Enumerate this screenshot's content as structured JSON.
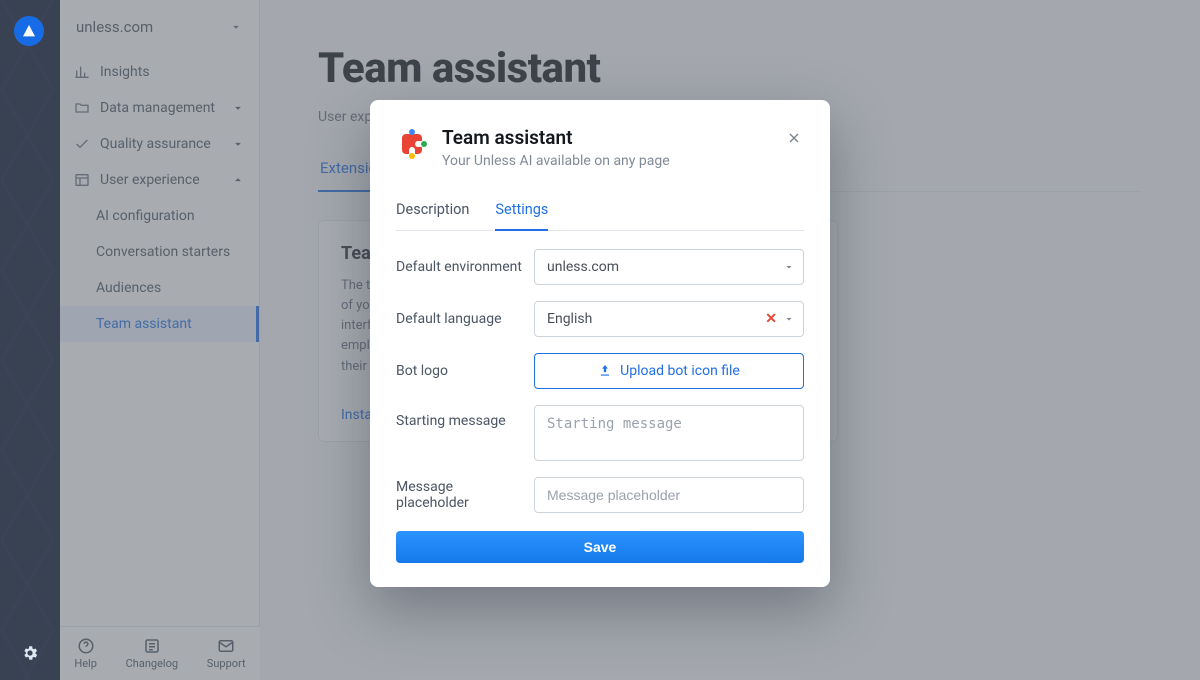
{
  "domain_label": "unless.com",
  "sidebar": {
    "insights": "Insights",
    "data_management": "Data management",
    "quality_assurance": "Quality assurance",
    "user_experience": "User experience",
    "sub": {
      "ai_configuration": "AI configuration",
      "conversation_starters": "Conversation starters",
      "audiences": "Audiences",
      "team_assistant": "Team assistant"
    }
  },
  "footer": {
    "help": "Help",
    "changelog": "Changelog",
    "support": "Support"
  },
  "page": {
    "title": "Team assistant",
    "subtitle": "User experience / Team assistant",
    "tabs": {
      "extensions": "Extensions"
    },
    "card": {
      "title": "Team assistant",
      "body": "The team assistant uses the same knowledge base, boundaries, and constraints of your audience-facing conversational AI. Installed on any system with an interface (ticketing system, CMS, helpdesk), it brings AI awareness to your employees, allowing them to answer questions fast and consistently, and improve their writing.",
      "install": "Install on Chrome"
    }
  },
  "modal": {
    "title": "Team assistant",
    "subtitle": "Your Unless AI available on any page",
    "tabs": {
      "description": "Description",
      "settings": "Settings"
    },
    "labels": {
      "default_environment": "Default environment",
      "default_language": "Default language",
      "bot_logo": "Bot logo",
      "starting_message": "Starting message",
      "message_placeholder": "Message placeholder"
    },
    "values": {
      "default_environment": "unless.com",
      "default_language": "English"
    },
    "placeholders": {
      "starting_message": "Starting message",
      "message_placeholder": "Message placeholder"
    },
    "upload_label": "Upload bot icon file",
    "save": "Save"
  }
}
